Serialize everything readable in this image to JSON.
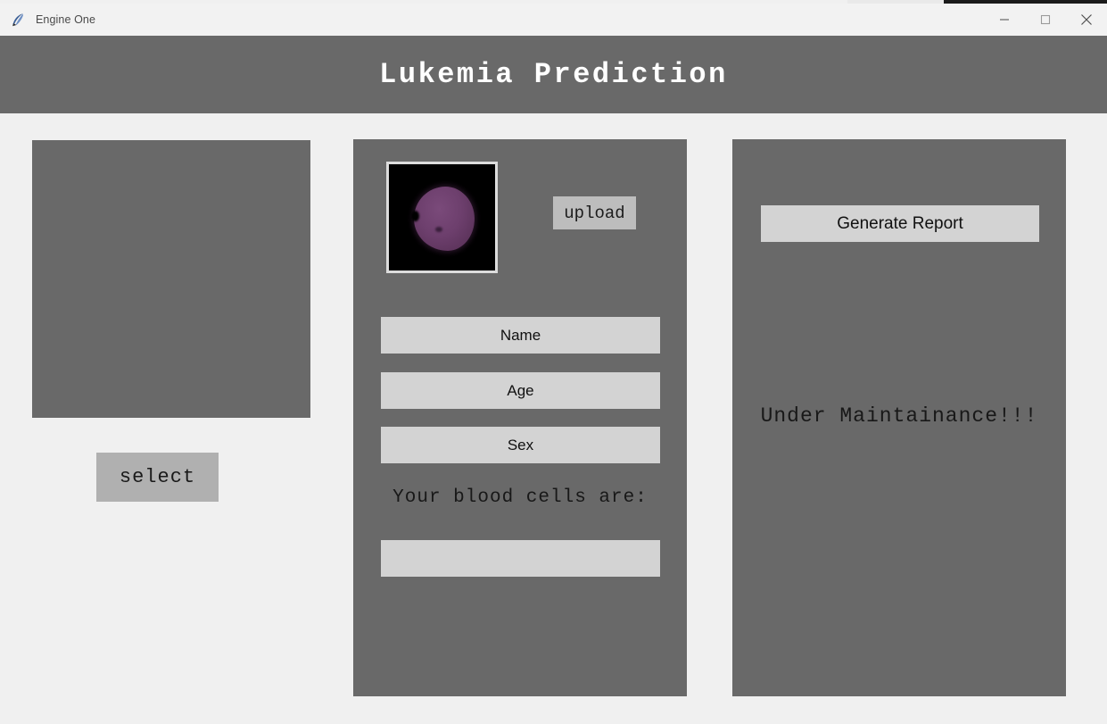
{
  "window": {
    "title": "Engine One",
    "icon": "feather-icon",
    "controls": [
      {
        "name": "minimize-button",
        "glyph": "minimize-icon"
      },
      {
        "name": "maximize-button",
        "glyph": "maximize-icon"
      },
      {
        "name": "close-button",
        "glyph": "close-icon"
      }
    ]
  },
  "header": {
    "title": "Lukemia Prediction"
  },
  "left_panel": {
    "preview_name": "image-preview-area",
    "select_button_label": "select"
  },
  "middle_panel": {
    "image_preview": {
      "name": "blood-cell-image",
      "description": "purple stained blood cell on black background"
    },
    "upload_button_label": "upload",
    "fields": [
      {
        "name": "name-field",
        "value": "Name",
        "placeholder": "Name"
      },
      {
        "name": "age-field",
        "value": "Age",
        "placeholder": "Age"
      },
      {
        "name": "sex-field",
        "value": "Sex",
        "placeholder": "Sex"
      }
    ],
    "result_label": "Your blood cells are:",
    "result_value": "",
    "result_placeholder": ""
  },
  "right_panel": {
    "generate_report_label": "Generate Report",
    "status_message": "Under Maintainance!!!"
  },
  "colors": {
    "panel_gray": "#696969",
    "page_background": "#f0f0f0",
    "field_gray": "#d3d3d3",
    "button_gray": "#b0b0b0",
    "upload_gray": "#bdbdbd",
    "header_text": "#ffffff",
    "cell_purple": "#6d3f6d"
  }
}
